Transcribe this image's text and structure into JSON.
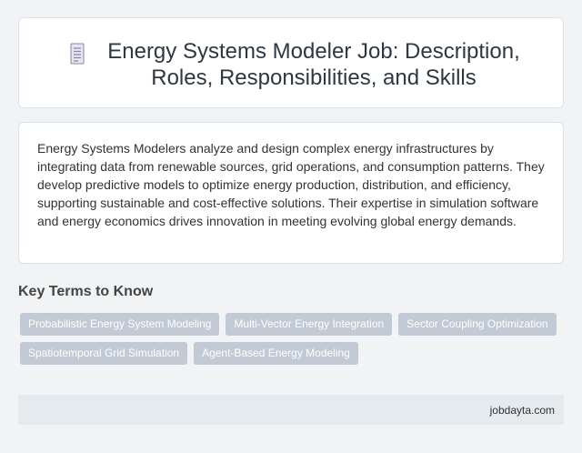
{
  "header": {
    "title": "Energy Systems Modeler Job: Description, Roles, Responsibilities, and Skills",
    "icon": "document-icon"
  },
  "description": "Energy Systems Modelers analyze and design complex energy infrastructures by integrating data from renewable sources, grid operations, and consumption patterns. They develop predictive models to optimize energy production, distribution, and efficiency, supporting sustainable and cost-effective solutions. Their expertise in simulation software and energy economics drives innovation in meeting evolving global energy demands.",
  "key_terms": {
    "heading": "Key Terms to Know",
    "items": [
      "Probabilistic Energy System Modeling",
      "Multi-Vector Energy Integration",
      "Sector Coupling Optimization",
      "Spatiotemporal Grid Simulation",
      "Agent-Based Energy Modeling"
    ]
  },
  "footer": {
    "site": "jobdayta.com"
  },
  "colors": {
    "tag_bg": "#c2cad6",
    "background": "#f1f3f5",
    "footer_bg": "#e4eaee"
  }
}
